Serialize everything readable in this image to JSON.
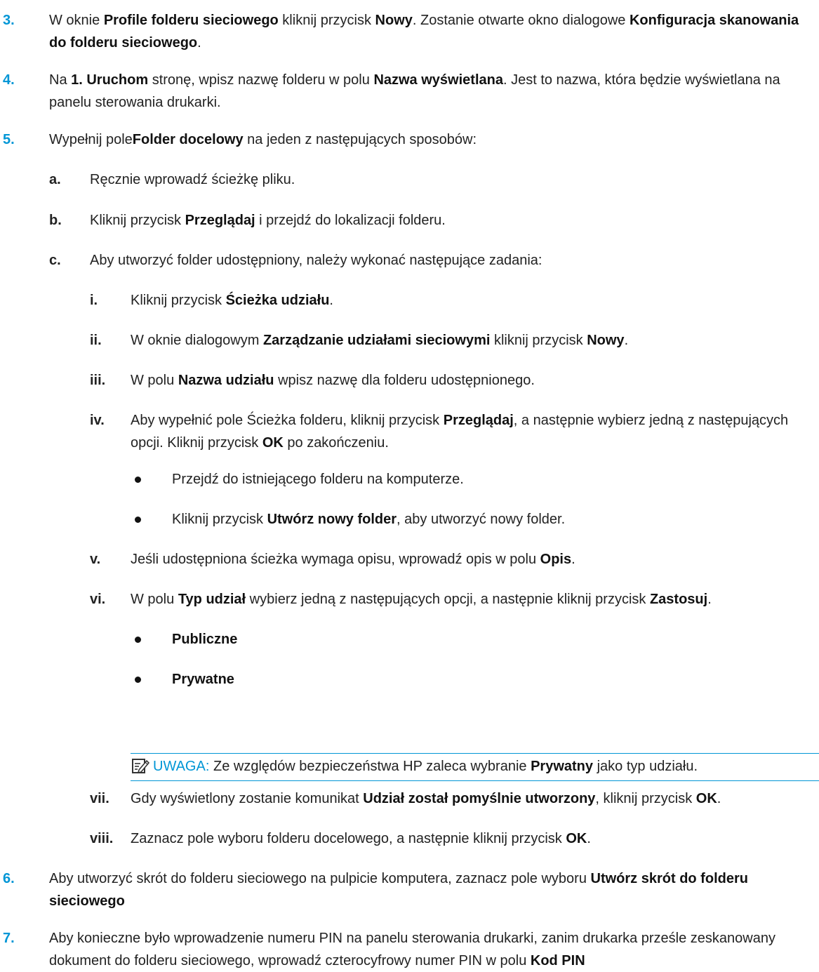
{
  "steps": [
    {
      "num": "3.",
      "parts": [
        "W oknie ",
        {
          "b": "Profile folderu sieciowego"
        },
        " kliknij przycisk ",
        {
          "b": "Nowy"
        },
        ". Zostanie otwarte okno dialogowe ",
        {
          "b": "Konfiguracja skanowania do folderu sieciowego"
        },
        "."
      ]
    },
    {
      "num": "4.",
      "parts": [
        "Na ",
        {
          "b": "1. Uruchom"
        },
        " stronę, wpisz nazwę folderu w polu ",
        {
          "b": "Nazwa wyświetlana"
        },
        ". Jest to nazwa, która będzie wyświetlana na panelu sterowania drukarki."
      ]
    },
    {
      "num": "5.",
      "parts": [
        "Wypełnij pole",
        {
          "b": "Folder docelowy"
        },
        " na jeden z następujących sposobów:"
      ]
    },
    {
      "num": "a.",
      "parts": [
        "Ręcznie wprowadź ścieżkę pliku."
      ]
    },
    {
      "num": "b.",
      "parts": [
        "Kliknij przycisk ",
        {
          "b": "Przeglądaj"
        },
        " i przejdź do lokalizacji folderu."
      ]
    },
    {
      "num": "c.",
      "parts": [
        "Aby utworzyć folder udostępniony, należy wykonać następujące zadania:"
      ]
    },
    {
      "num": "i.",
      "parts": [
        "Kliknij przycisk ",
        {
          "b": "Ścieżka udziału"
        },
        "."
      ]
    },
    {
      "num": "ii.",
      "parts": [
        "W oknie dialogowym ",
        {
          "b": "Zarządzanie udziałami sieciowymi"
        },
        " kliknij przycisk ",
        {
          "b": "Nowy"
        },
        "."
      ]
    },
    {
      "num": "iii.",
      "parts": [
        "W polu ",
        {
          "b": "Nazwa udziału"
        },
        " wpisz nazwę dla folderu udostępnionego."
      ]
    },
    {
      "num": "iv.",
      "parts": [
        "Aby wypełnić pole Ścieżka folderu, kliknij przycisk ",
        {
          "b": "Przeglądaj"
        },
        ", a następnie wybierz jedną z następujących opcji. Kliknij przycisk ",
        {
          "b": "OK"
        },
        " po zakończeniu."
      ]
    },
    {
      "num": "",
      "parts": [
        "Przejdź do istniejącego folderu na komputerze."
      ]
    },
    {
      "num": "",
      "parts": [
        "Kliknij przycisk ",
        {
          "b": "Utwórz nowy folder"
        },
        ", aby utworzyć nowy folder."
      ]
    },
    {
      "num": "v.",
      "parts": [
        "Jeśli udostępniona ścieżka wymaga opisu, wprowadź opis w polu ",
        {
          "b": "Opis"
        },
        "."
      ]
    },
    {
      "num": "vi.",
      "parts": [
        "W polu ",
        {
          "b": "Typ udział"
        },
        " wybierz jedną z następujących opcji, a następnie kliknij przycisk ",
        {
          "b": "Zastosuj"
        },
        "."
      ]
    },
    {
      "num": "",
      "parts": [
        {
          "b": "Publiczne"
        }
      ]
    },
    {
      "num": "",
      "parts": [
        {
          "b": "Prywatne"
        }
      ]
    },
    {
      "num": "vii.",
      "parts": [
        "Gdy wyświetlony zostanie komunikat ",
        {
          "b": "Udział został pomyślnie utworzony"
        },
        ", kliknij przycisk ",
        {
          "b": "OK"
        },
        "."
      ]
    },
    {
      "num": "viii.",
      "parts": [
        "Zaznacz pole wyboru folderu docelowego, a następnie kliknij przycisk ",
        {
          "b": "OK"
        },
        "."
      ]
    },
    {
      "num": "6.",
      "parts": [
        "Aby utworzyć skrót do folderu sieciowego na pulpicie komputera, zaznacz pole wyboru ",
        {
          "b": "Utwórz skrót do folderu sieciowego"
        }
      ]
    },
    {
      "num": "7.",
      "parts": [
        "Aby konieczne było wprowadzenie numeru PIN na panelu sterowania drukarki, zanim drukarka prześle zeskanowany dokument do folderu sieciowego, wprowadź czterocyfrowy numer PIN w polu ",
        {
          "b": "Kod PIN"
        }
      ]
    }
  ],
  "note": {
    "icon": "note-icon",
    "label": "UWAGA:",
    "parts": [
      "Ze względów bezpieczeństwa HP zaleca wybranie ",
      {
        "b": "Prywatny"
      },
      " jako typ udziału."
    ]
  },
  "colors": {
    "accent": "#0096d6",
    "text": "#222222"
  }
}
